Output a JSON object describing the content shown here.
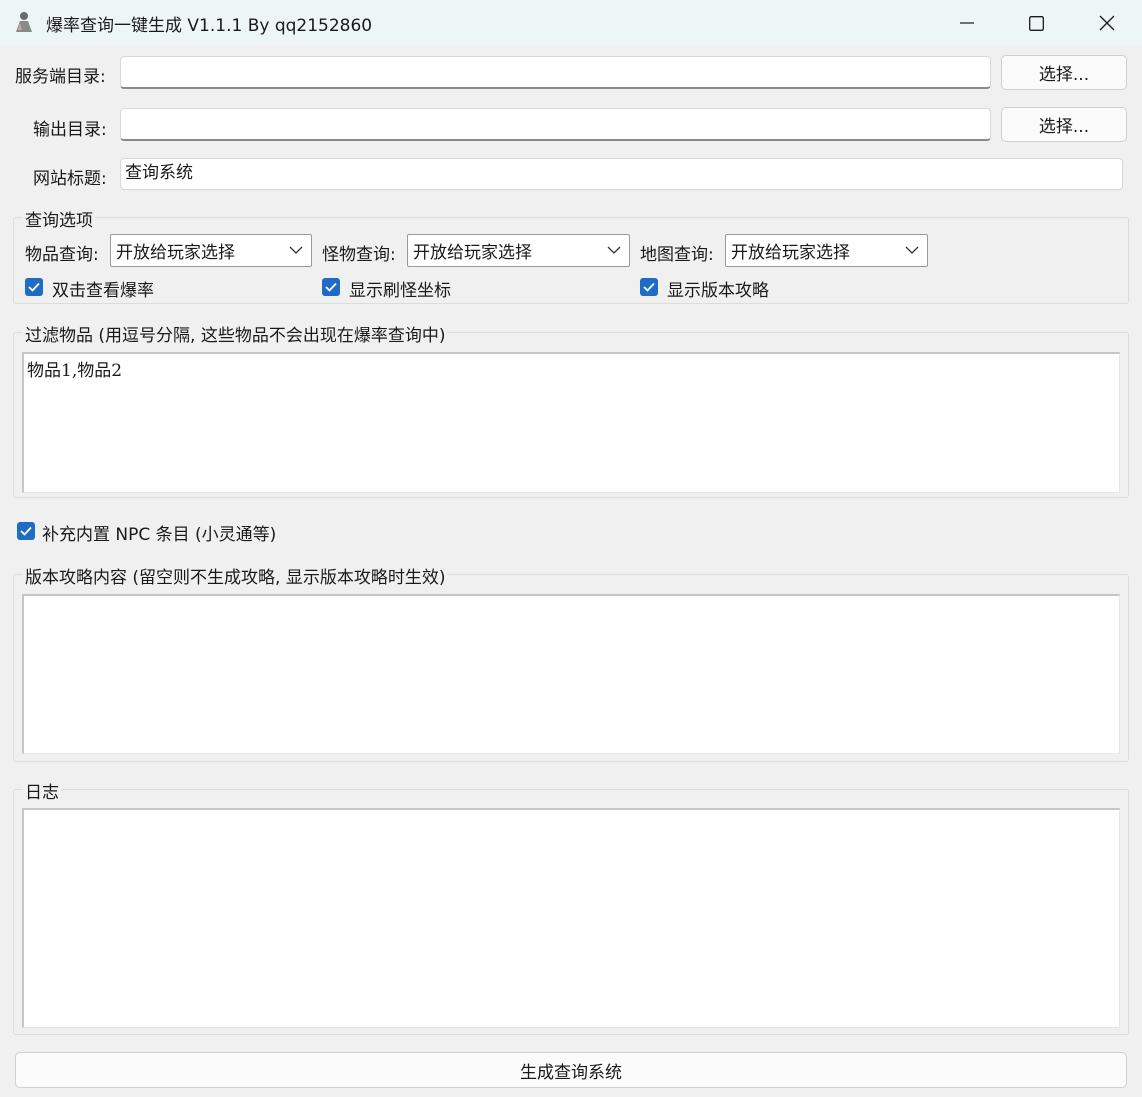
{
  "window": {
    "title": "爆率查询一键生成 V1.1.1 By qq2152860",
    "minimize_icon": "minimize-icon",
    "maximize_icon": "maximize-icon",
    "close_icon": "close-icon"
  },
  "server_dir": {
    "label": "服务端目录:",
    "value": "",
    "browse_label": "选择..."
  },
  "output_dir": {
    "label": "输出目录:",
    "value": "",
    "browse_label": "选择..."
  },
  "site_title": {
    "label": "网站标题:",
    "value": "查询系统"
  },
  "query_options": {
    "title": "查询选项",
    "item_query": {
      "label": "物品查询:",
      "selected": "开放给玩家选择"
    },
    "monster_query": {
      "label": "怪物查询:",
      "selected": "开放给玩家选择"
    },
    "map_query": {
      "label": "地图查询:",
      "selected": "开放给玩家选择"
    },
    "checkboxes": [
      {
        "label": "双击查看爆率",
        "checked": true
      },
      {
        "label": "显示刷怪坐标",
        "checked": true
      },
      {
        "label": "显示版本攻略",
        "checked": true
      }
    ]
  },
  "filter_items": {
    "title": "过滤物品 (用逗号分隔, 这些物品不会出现在爆率查询中)",
    "value": "物品1,物品2"
  },
  "npc_option": {
    "label": "补充内置 NPC 条目 (小灵通等)",
    "checked": true
  },
  "guide_content": {
    "title": "版本攻略内容 (留空则不生成攻略, 显示版本攻略时生效)",
    "value": ""
  },
  "log": {
    "title": "日志",
    "value": ""
  },
  "generate_button": {
    "label": "生成查询系统"
  },
  "colors": {
    "accent": "#1f6cc5",
    "background": "#f0f0f0",
    "titlebar": "#eef5f7"
  }
}
